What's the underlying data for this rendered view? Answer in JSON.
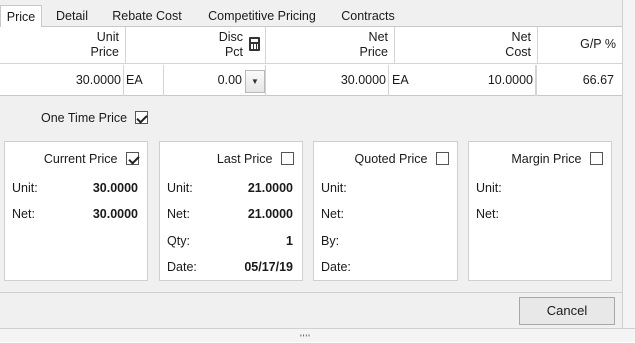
{
  "tabs": [
    "Price",
    "Detail",
    "Rebate Cost",
    "Competitive Pricing",
    "Contracts"
  ],
  "grid": {
    "headers": {
      "unit_price": [
        "Unit",
        "Price"
      ],
      "disc_pct": [
        "Disc",
        "Pct"
      ],
      "net_price": [
        "Net",
        "Price"
      ],
      "net_cost": [
        "Net",
        "Cost"
      ],
      "gp_pct": "G/P %"
    },
    "row": {
      "unit_price": "30.0000",
      "unit_uom": "EA",
      "disc_pct": "0.00",
      "net_price": "30.0000",
      "net_uom": "EA",
      "net_cost": "10.0000",
      "gp_pct": "66.67"
    }
  },
  "one_time_price": {
    "label": "One Time Price",
    "checked": true
  },
  "panels": {
    "current": {
      "title": "Current Price",
      "checked": true,
      "unit_label": "Unit:",
      "unit_value": "30.0000",
      "net_label": "Net:",
      "net_value": "30.0000"
    },
    "last": {
      "title": "Last Price",
      "checked": false,
      "unit_label": "Unit:",
      "unit_value": "21.0000",
      "net_label": "Net:",
      "net_value": "21.0000",
      "qty_label": "Qty:",
      "qty_value": "1",
      "date_label": "Date:",
      "date_value": "05/17/19"
    },
    "quoted": {
      "title": "Quoted Price",
      "checked": false,
      "unit_label": "Unit:",
      "net_label": "Net:",
      "by_label": "By:",
      "date_label": "Date:"
    },
    "margin": {
      "title": "Margin Price",
      "checked": false,
      "unit_label": "Unit:",
      "net_label": "Net:"
    }
  },
  "buttons": {
    "cancel": "Cancel"
  },
  "icons": {
    "calculator": "calculator-icon",
    "dropdown": "chevron-down-icon"
  }
}
